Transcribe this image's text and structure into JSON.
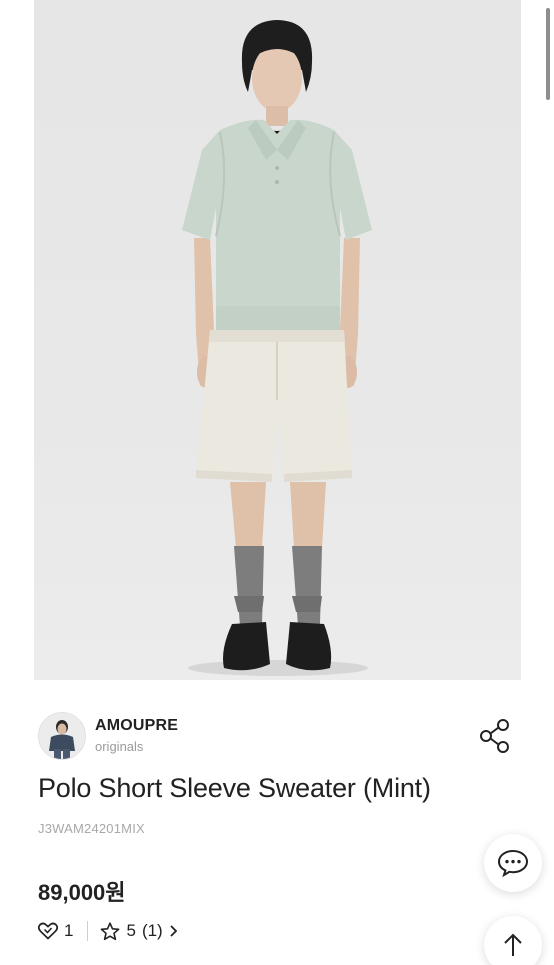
{
  "product": {
    "brand_name": "AMOUPRE",
    "brand_sub": "originals",
    "title": "Polo Short Sleeve Sweater (Mint)",
    "code": "J3WAM24201MIX",
    "price": "89,000원",
    "likes": "1",
    "rating": "5",
    "review_count": "(1)"
  },
  "icons": {
    "share": "share-icon",
    "like": "heart-icon",
    "star": "star-icon",
    "chevron": "chevron-right-icon",
    "chat": "chat-icon",
    "top": "arrow-up-icon"
  },
  "colors": {
    "shirt": "#c9d6cc",
    "shorts": "#ebe8df",
    "socks": "#7d7d7d",
    "shoes": "#1d1d1d",
    "background": "#e8e8e8"
  }
}
